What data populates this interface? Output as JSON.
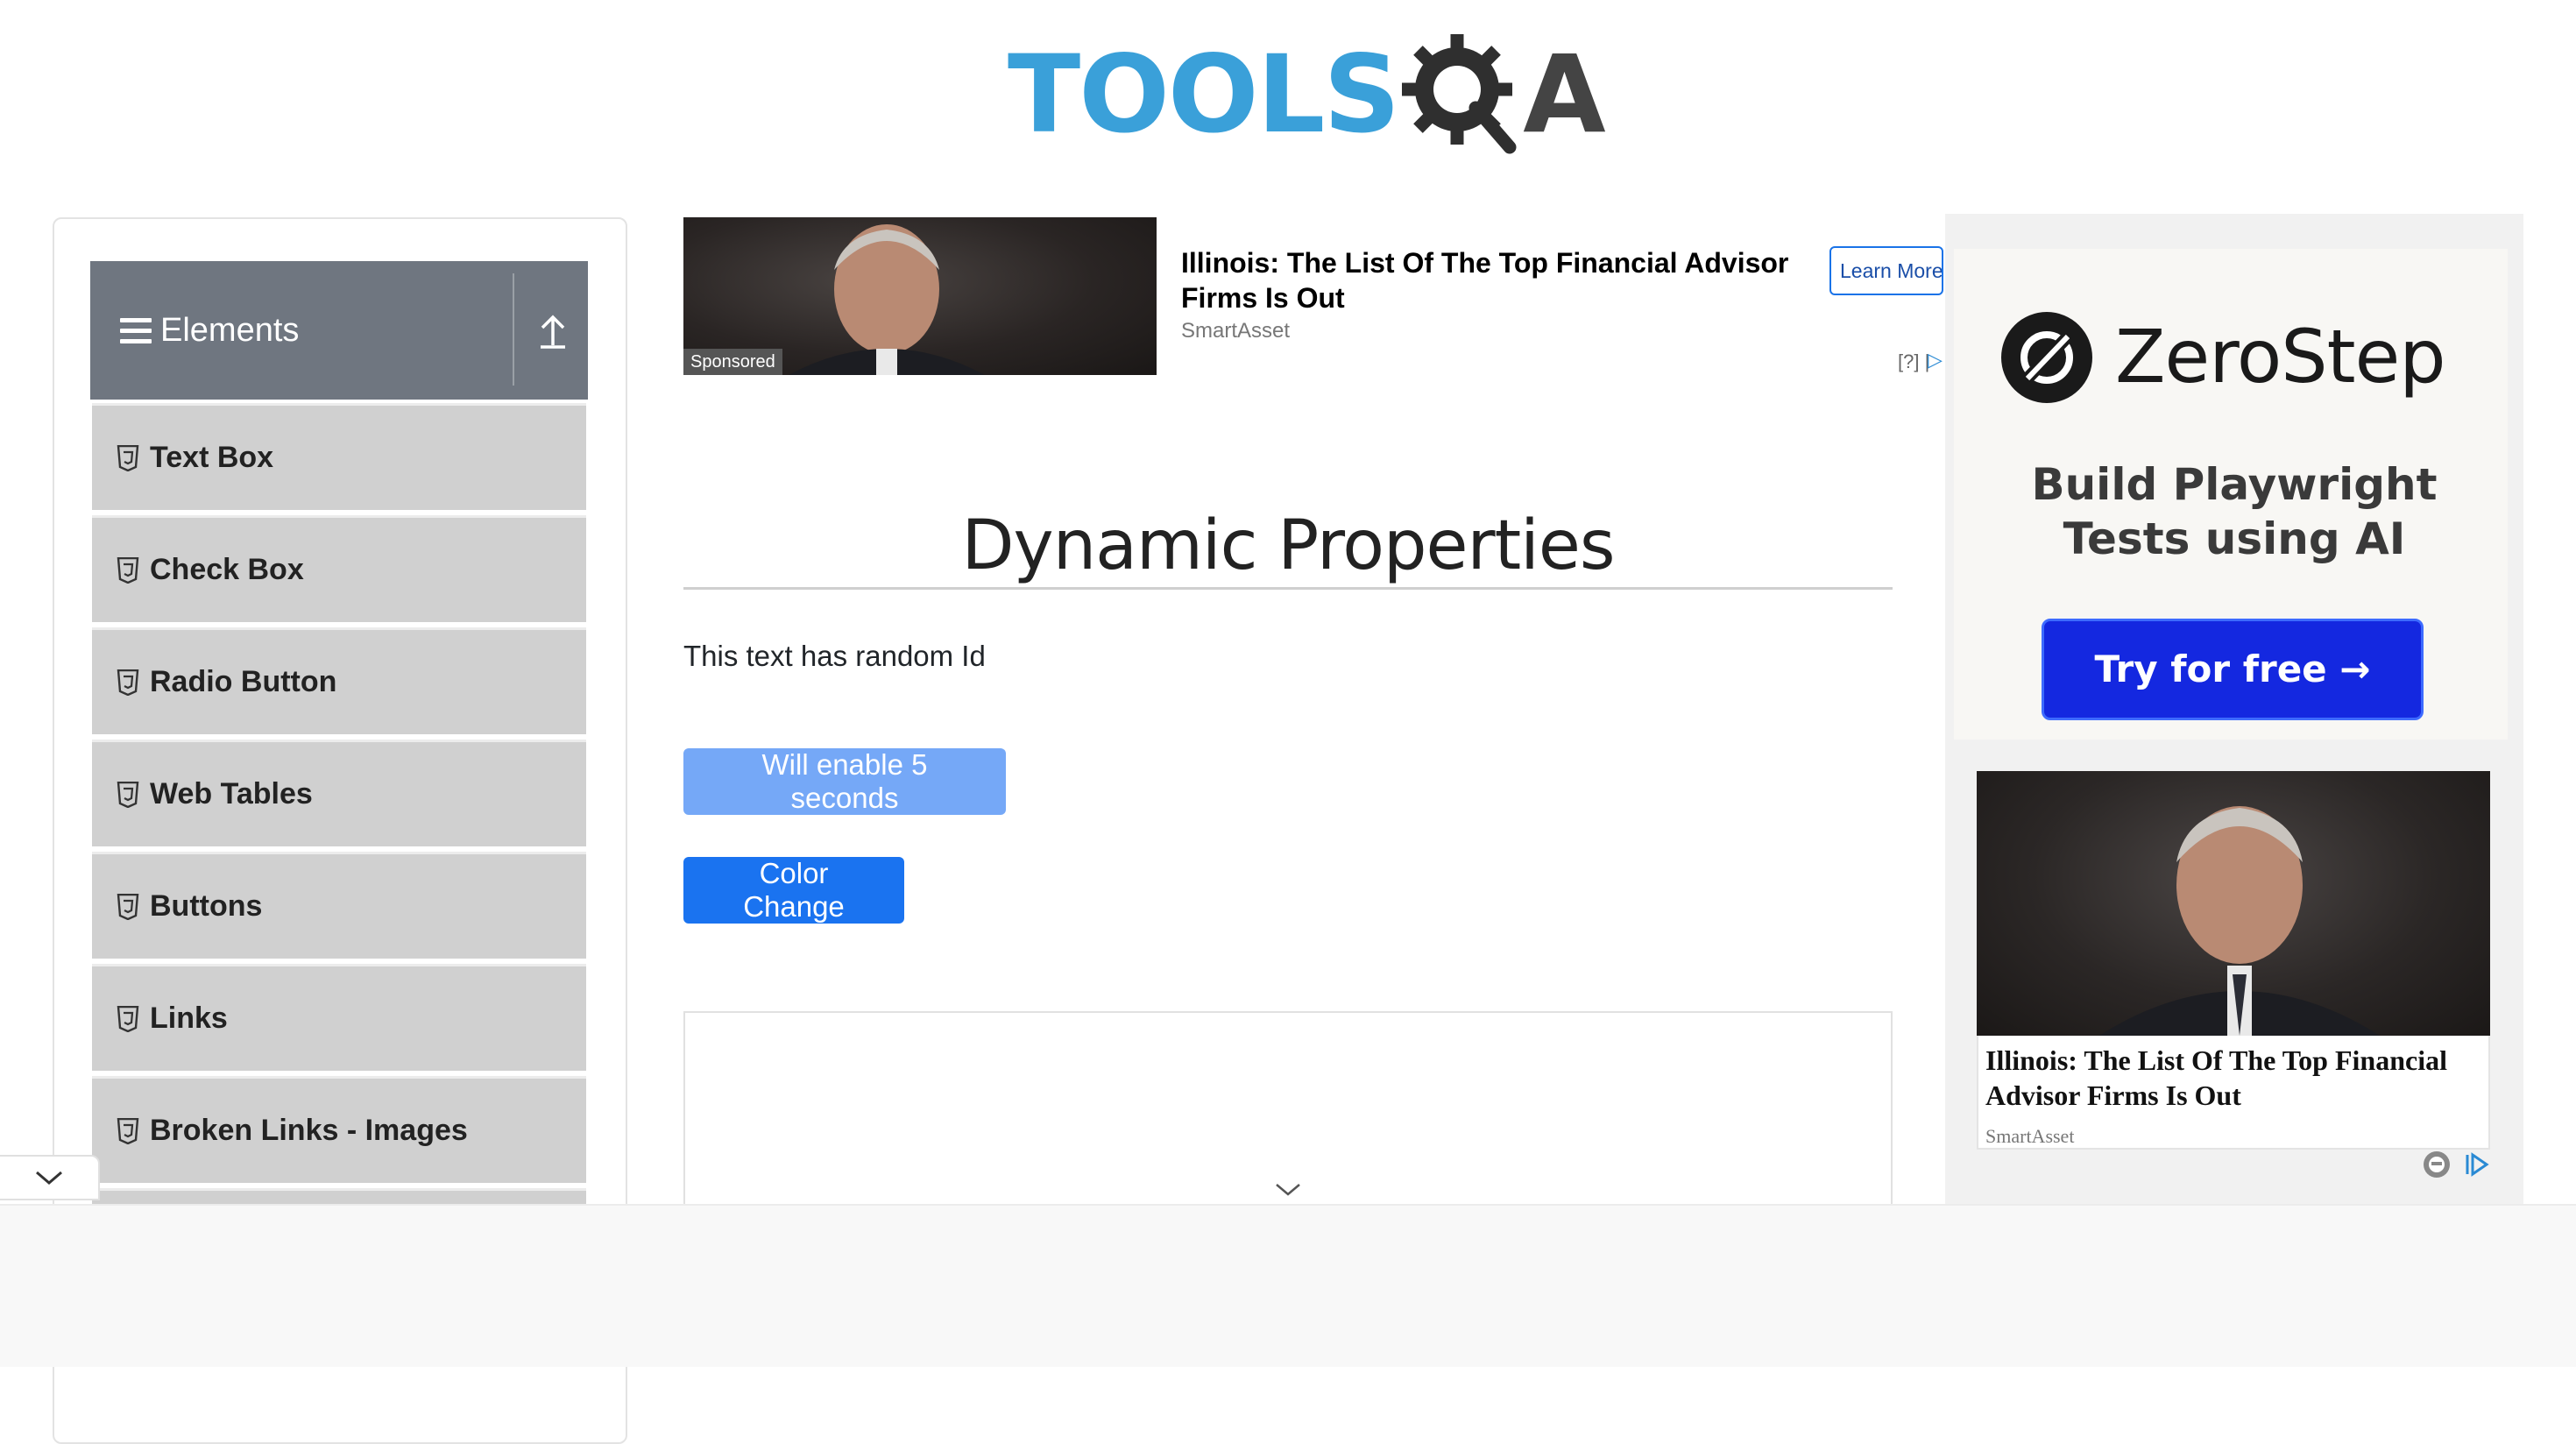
{
  "header": {
    "logo_tools": "TOOLS",
    "logo_a": "A"
  },
  "sidebar": {
    "group_title": "Elements",
    "items": [
      {
        "label": "Text Box"
      },
      {
        "label": "Check Box"
      },
      {
        "label": "Radio Button"
      },
      {
        "label": "Web Tables"
      },
      {
        "label": "Buttons"
      },
      {
        "label": "Links"
      },
      {
        "label": "Broken Links - Images"
      }
    ]
  },
  "top_ad": {
    "sponsored": "Sponsored",
    "headline": "Illinois: The List Of The Top Financial Advisor Firms Is Out",
    "source": "SmartAsset",
    "cta": "Learn More",
    "choices": "[?] |"
  },
  "main": {
    "title": "Dynamic Properties",
    "random_text": "This text has random Id",
    "disabled_button": "Will enable 5 seconds",
    "color_button": "Color Change"
  },
  "right_ad": {
    "brand": "ZeroStep",
    "tagline": "Build Playwright Tests using AI",
    "cta": "Try for free →",
    "headline": "Illinois: The List Of The Top Financial Advisor Firms Is Out",
    "source": "SmartAsset"
  },
  "colors": {
    "primary": "#1a73f0",
    "primary_disabled": "#75a8f7",
    "sidebar_header": "#6f7680",
    "sidebar_item": "#d0d0d0",
    "zerostep_cta": "#1428e0",
    "logo_blue": "#3aa0d9"
  },
  "icons": {
    "hamburger": "hamburger-icon",
    "upload": "upload-icon",
    "menu_item": "html5-icon",
    "collapse": "chevron-down-icon",
    "zerostep": "zerostep-logo-icon"
  }
}
